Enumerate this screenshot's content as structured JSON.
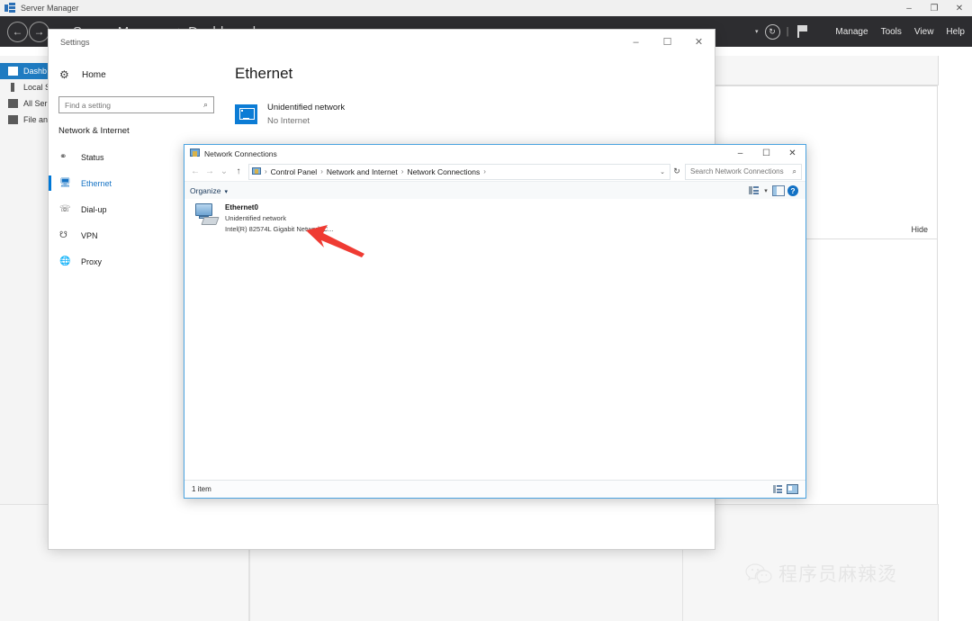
{
  "server_manager": {
    "titlebar": {
      "icon": "server-manager-icon",
      "title": "Server Manager",
      "minimize": "–",
      "maximize": "❐",
      "close": "✕"
    },
    "nav": {
      "back_icon": "←",
      "forward_icon": "→",
      "hamburger_icon": "≡",
      "breadcrumb": "Server Manager ‣ Dashboard",
      "caret_icon": "▾",
      "refresh_icon": "↻",
      "separator": "|",
      "flag_icon": "notifications-flag-icon",
      "menu": [
        "Manage",
        "Tools",
        "View",
        "Help"
      ]
    },
    "sidebar": [
      {
        "label": "Dashb",
        "icon": "grid-icon",
        "active": true
      },
      {
        "label": "Local S",
        "icon": "server-icon",
        "active": false
      },
      {
        "label": "All Ser",
        "icon": "servers-icon",
        "active": false
      },
      {
        "label": "File an",
        "icon": "file-services-icon",
        "active": false
      }
    ],
    "panel": {
      "hide_label": "Hide"
    }
  },
  "settings": {
    "titlebar": {
      "title": "Settings",
      "minimize": "–",
      "maximize": "☐",
      "close": "✕"
    },
    "home": {
      "icon": "gear-icon",
      "label": "Home"
    },
    "search": {
      "placeholder": "Find a setting",
      "value": "",
      "icon": "search-icon"
    },
    "section_title": "Network & Internet",
    "nav_items": [
      {
        "label": "Status",
        "icon": "globe-status-icon",
        "active": false
      },
      {
        "label": "Ethernet",
        "icon": "ethernet-icon",
        "active": true
      },
      {
        "label": "Dial-up",
        "icon": "dialup-icon",
        "active": false
      },
      {
        "label": "VPN",
        "icon": "vpn-icon",
        "active": false
      },
      {
        "label": "Proxy",
        "icon": "globe-icon",
        "active": false
      }
    ],
    "main": {
      "heading": "Ethernet",
      "network": {
        "icon": "network-monitor-icon",
        "name": "Unidentified network",
        "status": "No Internet"
      }
    },
    "accent_color": "#0078d7"
  },
  "network_connections": {
    "titlebar": {
      "icon": "network-connections-icon",
      "title": "Network Connections",
      "minimize": "–",
      "maximize": "☐",
      "close": "✕"
    },
    "navbar": {
      "back_icon": "←",
      "forward_icon": "→",
      "recent_icon": "⌄",
      "up_icon": "↑",
      "crumb_icon": "network-connections-icon",
      "breadcrumbs": [
        "Control Panel",
        "Network and Internet",
        "Network Connections"
      ],
      "separator": "›",
      "dropdown_icon": "⌄",
      "refresh_icon": "↻",
      "search": {
        "placeholder": "Search Network Connections",
        "value": "",
        "icon": "search-icon"
      }
    },
    "toolbar": {
      "organize_label": "Organize",
      "organize_caret": "▾",
      "change_view_icon": "change-view-icon",
      "view_caret": "▾",
      "preview_pane_icon": "preview-pane-icon",
      "help_icon": "?"
    },
    "items": [
      {
        "icon": "network-adapter-icon",
        "name": "Ethernet0",
        "status": "Unidentified network",
        "device": "Intel(R) 82574L Gigabit Network C..."
      }
    ],
    "status_bar": {
      "count_label": "1 item",
      "details_view_icon": "details-view-icon",
      "large_icons_view_icon": "large-icons-view-icon"
    },
    "border_color": "#4aa3e0"
  },
  "annotation": {
    "arrow": {
      "name": "red-pointer-arrow",
      "color": "#ef3b33"
    }
  },
  "watermark": {
    "logo": "wechat-icon",
    "text": "程序员麻辣烫"
  }
}
